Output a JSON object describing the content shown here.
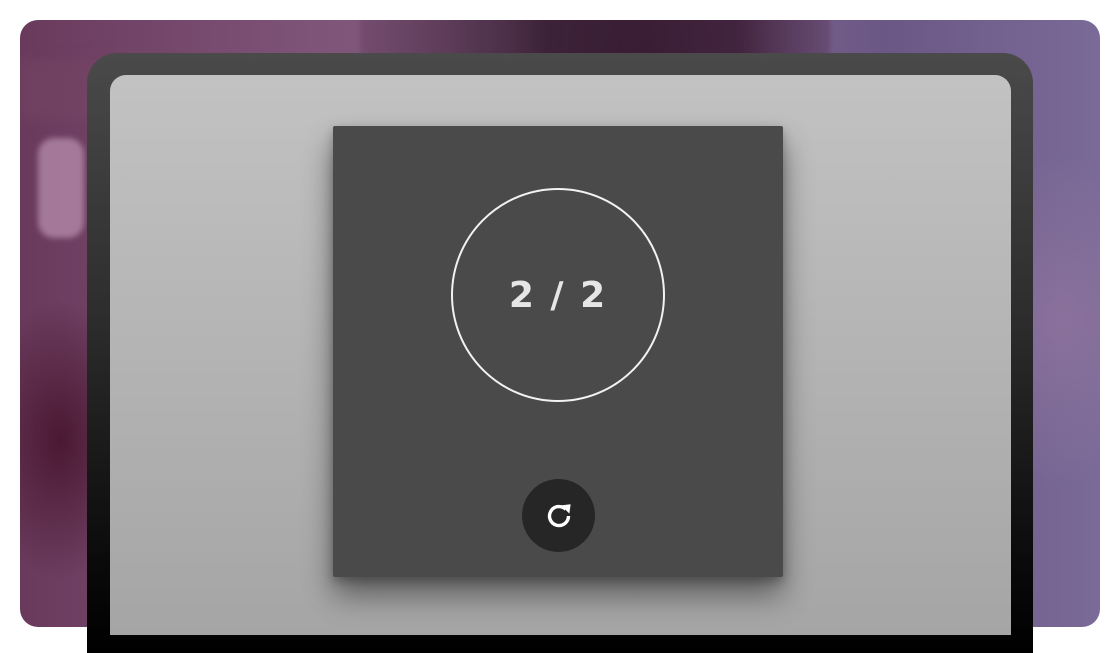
{
  "player": {
    "counter": {
      "current": "2",
      "separator": "/",
      "total": "2",
      "label": "2 / 2"
    },
    "reload_button": {
      "icon": "reload-icon",
      "aria_label": "Replay"
    }
  },
  "colors": {
    "card_background": "#4a4a4a",
    "ring": "#f2f2f2",
    "counter_text": "#e6e6e6",
    "reload_button_background": "#262626",
    "screen_top": "#c2c2c2",
    "screen_bottom": "#a5a5a5",
    "device_frame": "#2c2c2c"
  }
}
